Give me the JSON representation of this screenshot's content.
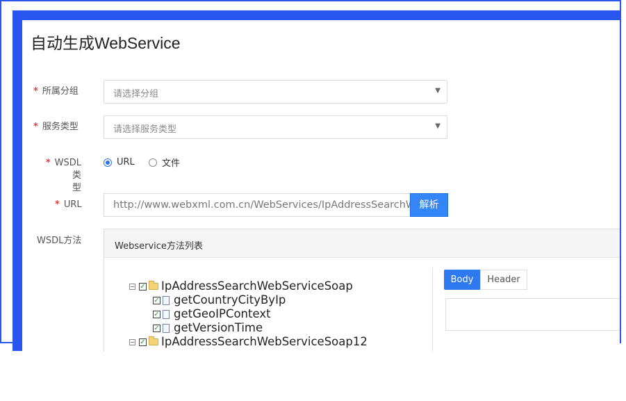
{
  "page": {
    "title": "自动生成WebService"
  },
  "form": {
    "required_mark": "*",
    "group": {
      "label": "所属分组",
      "placeholder": "请选择分组"
    },
    "service_type": {
      "label": "服务类型",
      "placeholder": "请选择服务类型"
    },
    "wsdl_type": {
      "label_line1": "WSDL类",
      "label_line2": "型",
      "options": [
        {
          "label": "URL",
          "selected": true
        },
        {
          "label": "文件",
          "selected": false
        }
      ]
    },
    "url": {
      "label": "URL",
      "value": "http://www.webxml.com.cn/WebServices/IpAddressSearchWebService.asmx?wsdl",
      "parse_button": "解析"
    },
    "wsdl_methods": {
      "label": "WSDL方法"
    }
  },
  "methods_panel": {
    "title": "Webservice方法列表",
    "tree": [
      {
        "name": "IpAddressSearchWebServiceSoap",
        "kind": "folder",
        "expanded": true,
        "checked": true,
        "children": [
          {
            "name": "getCountryCityByIp",
            "checked": true
          },
          {
            "name": "getGeoIPContext",
            "checked": true
          },
          {
            "name": "getVersionTime",
            "checked": true
          }
        ]
      },
      {
        "name": "IpAddressSearchWebServiceSoap12",
        "kind": "folder",
        "expanded": true,
        "checked": true
      }
    ],
    "tabs": [
      {
        "label": "Body",
        "active": true
      },
      {
        "label": "Header",
        "active": false
      }
    ]
  },
  "colors": {
    "accent": "#2a56f0",
    "primary_button": "#3485f7",
    "required": "#e23c3c"
  }
}
